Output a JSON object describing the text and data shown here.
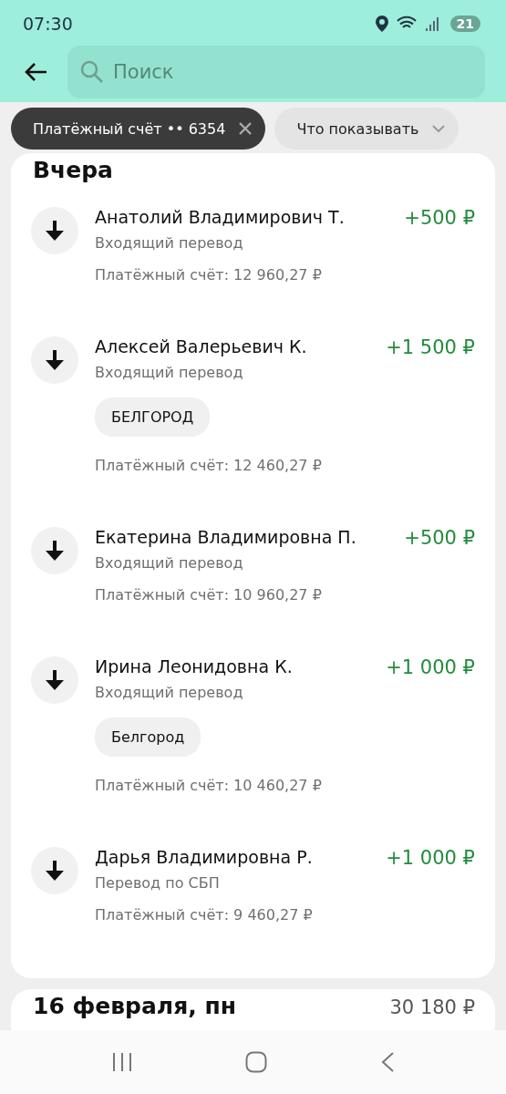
{
  "status_bar": {
    "time": "07:30",
    "battery": "21"
  },
  "header": {
    "search": {
      "placeholder": "Поиск"
    }
  },
  "filters": [
    {
      "label": "Платёжный счёт •• 6354",
      "kind": "active"
    },
    {
      "label": "Что показывать",
      "kind": "dropdown"
    }
  ],
  "groups": [
    {
      "title": "Вчера",
      "transactions": [
        {
          "name": "Анатолий Владимирович Т.",
          "type": "Входящий перевод",
          "amount": "+500 ₽",
          "balance": "Платёжный счёт: 12 960,27 ₽"
        },
        {
          "name": "Алексей Валерьевич К.",
          "type": "Входящий перевод",
          "amount": "+1 500 ₽",
          "tag": "БЕЛГОРОД",
          "balance": "Платёжный счёт: 12 460,27 ₽"
        },
        {
          "name": "Екатерина Владимировна П.",
          "type": "Входящий перевод",
          "amount": "+500 ₽",
          "balance": "Платёжный счёт: 10 960,27 ₽"
        },
        {
          "name": "Ирина Леонидовна К.",
          "type": "Входящий перевод",
          "amount": "+1 000 ₽",
          "tag": "Белгород",
          "balance": "Платёжный счёт: 10 460,27 ₽"
        },
        {
          "name": "Дарья Владимировна Р.",
          "type": "Перевод по СБП",
          "amount": "+1 000 ₽",
          "balance": "Платёжный счёт: 9 460,27 ₽"
        }
      ]
    },
    {
      "title": "16 февраля, пн",
      "total": "30 180 ₽"
    }
  ]
}
